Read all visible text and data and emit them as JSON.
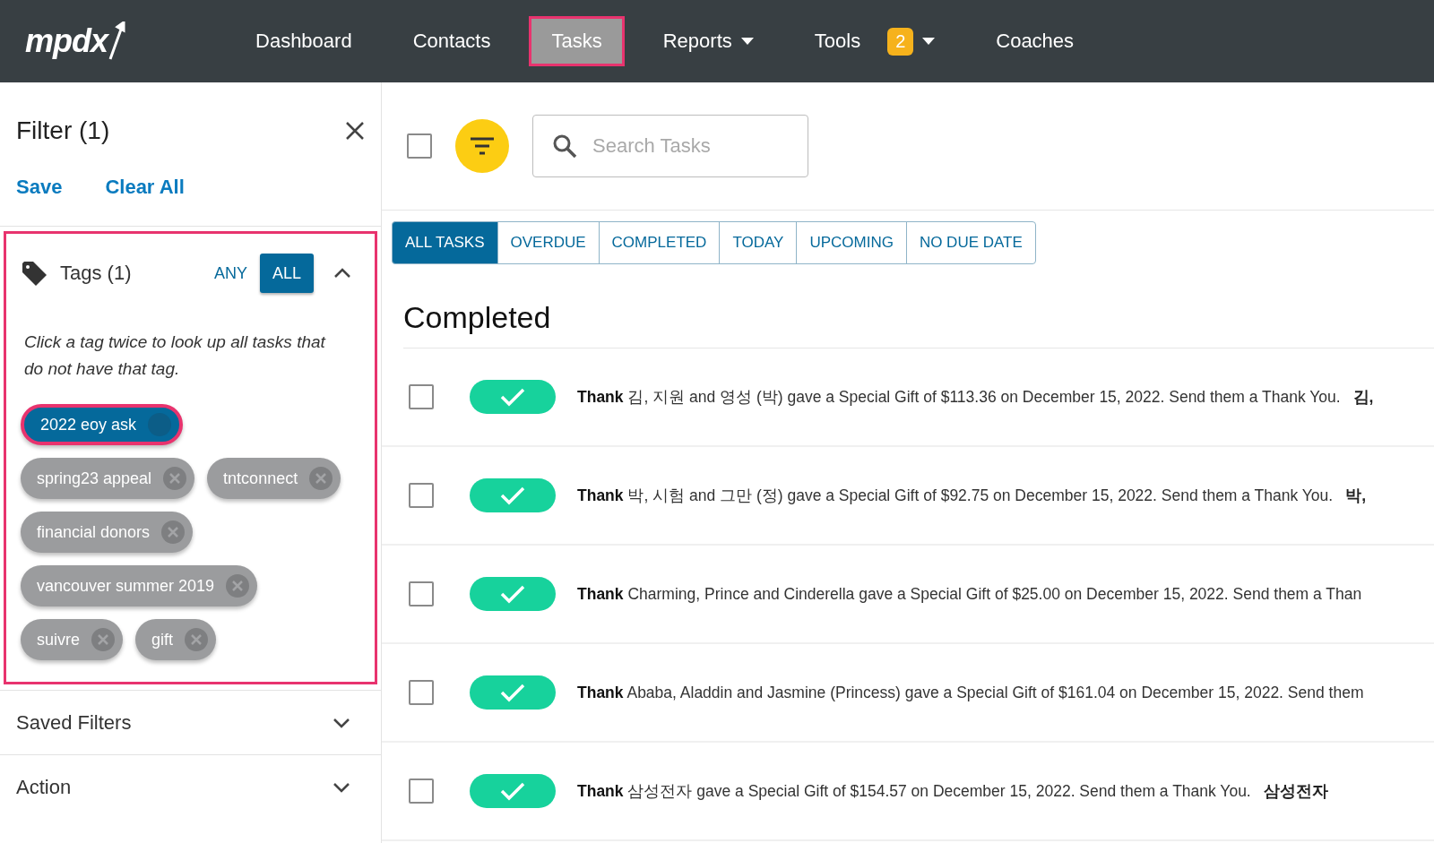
{
  "nav": {
    "logo": "mpdx",
    "items": [
      {
        "label": "Dashboard",
        "selected": false
      },
      {
        "label": "Contacts",
        "selected": false
      },
      {
        "label": "Tasks",
        "selected": true
      },
      {
        "label": "Reports",
        "selected": false,
        "dropdown": true
      },
      {
        "label": "Tools",
        "selected": false,
        "dropdown": true,
        "badge": "2"
      },
      {
        "label": "Coaches",
        "selected": false
      }
    ]
  },
  "filter": {
    "title": "Filter (1)",
    "save": "Save",
    "clear_all": "Clear All",
    "tags": {
      "title": "Tags (1)",
      "expanded": true,
      "modes": [
        {
          "label": "ANY",
          "selected": false
        },
        {
          "label": "ALL",
          "selected": true
        }
      ],
      "hint": "Click a tag twice to look up all tasks that do not have that tag.",
      "items": [
        {
          "label": "2022 eoy ask",
          "selected": true
        },
        {
          "label": "spring23 appeal",
          "selected": false
        },
        {
          "label": "tntconnect",
          "selected": false
        },
        {
          "label": "financial donors",
          "selected": false
        },
        {
          "label": "vancouver summer 2019",
          "selected": false
        },
        {
          "label": "suivre",
          "selected": false
        },
        {
          "label": "gift",
          "selected": false
        }
      ]
    },
    "sections": [
      {
        "label": "Saved Filters",
        "expanded": false
      },
      {
        "label": "Action",
        "expanded": false
      }
    ]
  },
  "select_all": {
    "checked": false
  },
  "search": {
    "placeholder": "Search Tasks"
  },
  "tabs": [
    {
      "label": "ALL TASKS",
      "selected": true
    },
    {
      "label": "OVERDUE",
      "selected": false
    },
    {
      "label": "COMPLETED",
      "selected": false
    },
    {
      "label": "TODAY",
      "selected": false
    },
    {
      "label": "UPCOMING",
      "selected": false
    },
    {
      "label": "NO DUE DATE",
      "selected": false
    }
  ],
  "heading": "Completed",
  "tasks": [
    {
      "checked": false,
      "completed": true,
      "action": "Thank",
      "text": "김, 지원 and 영성 (박) gave a Special Gift of $113.36 on December 15, 2022. Send them a Thank You.",
      "contact": "김,"
    },
    {
      "checked": false,
      "completed": true,
      "action": "Thank",
      "text": "박, 시험 and 그만 (정) gave a Special Gift of $92.75 on December 15, 2022. Send them a Thank You.",
      "contact": "박,"
    },
    {
      "checked": false,
      "completed": true,
      "action": "Thank",
      "text": "Charming, Prince and Cinderella gave a Special Gift of $25.00 on December 15, 2022. Send them a Than"
    },
    {
      "checked": false,
      "completed": true,
      "action": "Thank",
      "text": "Ababa, Aladdin and Jasmine (Princess) gave a Special Gift of $161.04 on December 15, 2022. Send them"
    },
    {
      "checked": false,
      "completed": true,
      "action": "Thank",
      "text": "삼성전자 gave a Special Gift of $154.57 on December 15, 2022. Send them a Thank You.",
      "contact": "삼성전자"
    }
  ]
}
